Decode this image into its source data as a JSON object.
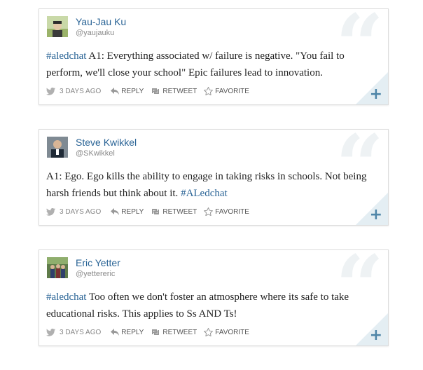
{
  "colors": {
    "link": "#2a6496",
    "plus": "#4f86a8",
    "corner": "#e4eef3"
  },
  "tweets": [
    {
      "name": "Yau-Jau Ku",
      "handle": "@yaujauku",
      "hashtag": "#aledchat",
      "text": " A1: Everything associated w/ failure is negative. \"You fail to perform, we'll close your school\" Epic failures lead to innovation.",
      "time": "3 DAYS AGO",
      "reply": "REPLY",
      "retweet": "RETWEET",
      "favorite": "FAVORITE"
    },
    {
      "name": "Steve Kwikkel",
      "handle": "@SKwikkel",
      "text": "A1: Ego. Ego kills the ability to engage in taking risks in schools. Not being harsh friends but think about it. ",
      "hashtag": "#ALedchat",
      "time": "3 DAYS AGO",
      "reply": "REPLY",
      "retweet": "RETWEET",
      "favorite": "FAVORITE"
    },
    {
      "name": "Eric Yetter",
      "handle": "@yettereric",
      "hashtag": "#aledchat",
      "text": " Too often we don't foster an atmosphere where its safe to take educational risks. This applies to Ss AND Ts!",
      "time": "3 DAYS AGO",
      "reply": "REPLY",
      "retweet": "RETWEET",
      "favorite": "FAVORITE"
    }
  ]
}
